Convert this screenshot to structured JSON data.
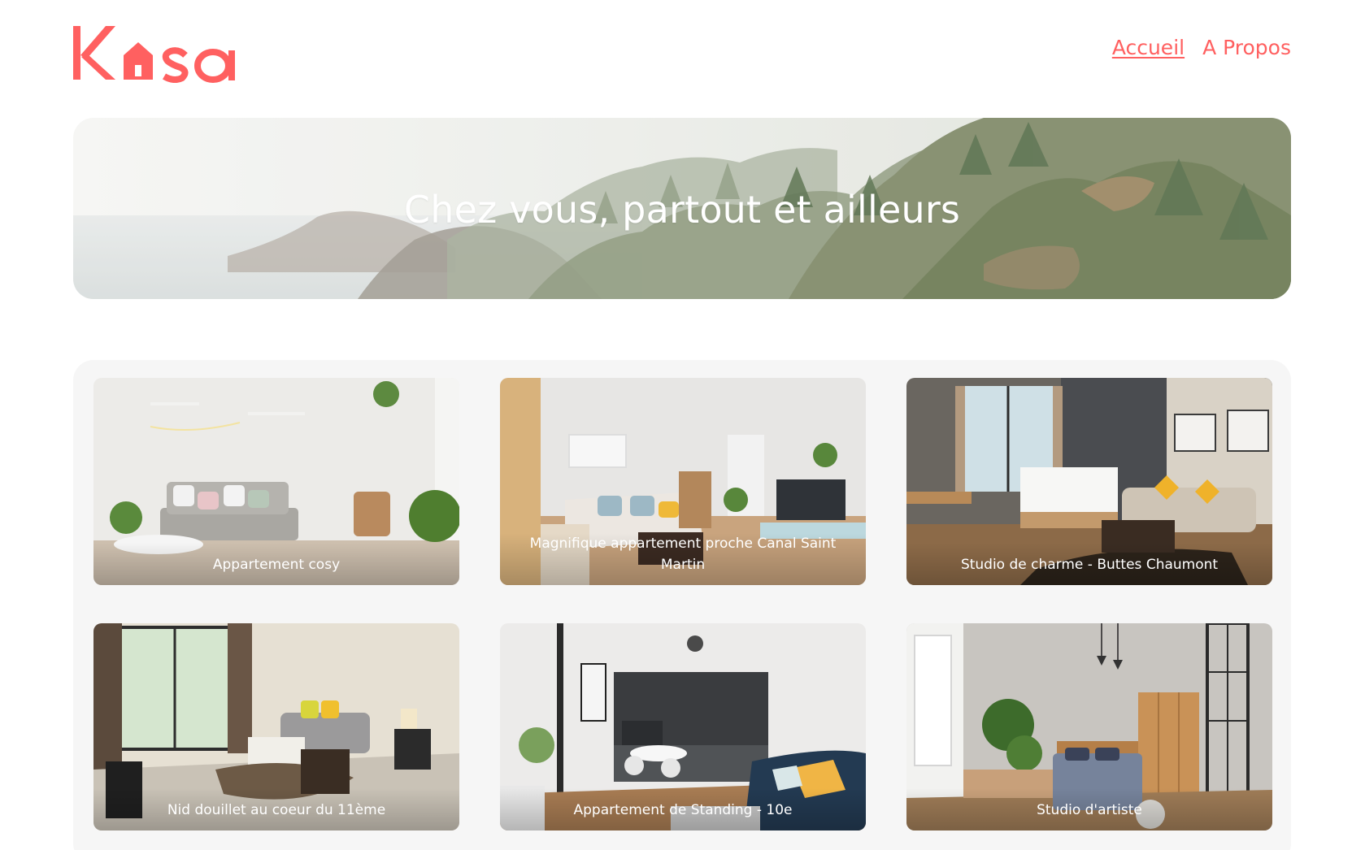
{
  "brand": {
    "name": "Kasa",
    "accent_color": "#FF6060"
  },
  "nav": {
    "items": [
      {
        "label": "Accueil",
        "active": true
      },
      {
        "label": "A Propos",
        "active": false
      }
    ]
  },
  "banner": {
    "title": "Chez vous, partout et ailleurs"
  },
  "gallery": {
    "cards": [
      {
        "title": "Appartement cosy"
      },
      {
        "title": "Magnifique appartement proche Canal Saint Martin"
      },
      {
        "title": "Studio de charme - Buttes Chaumont"
      },
      {
        "title": "Nid douillet au coeur du 11ème"
      },
      {
        "title": "Appartement de Standing - 10e"
      },
      {
        "title": "Studio d'artiste"
      }
    ]
  }
}
